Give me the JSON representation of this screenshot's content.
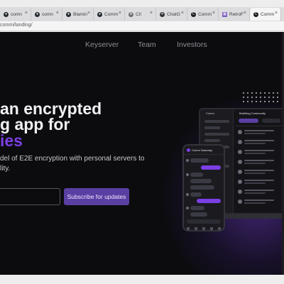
{
  "browser": {
    "tabs": [
      {
        "label": "comn",
        "favicon": "github-icon",
        "active": false
      },
      {
        "label": "comn",
        "favicon": "github-icon",
        "active": false
      },
      {
        "label": "Blamin",
        "favicon": "github-icon",
        "active": false
      },
      {
        "label": "Comm",
        "favicon": "github-icon",
        "active": false
      },
      {
        "label": "CI/",
        "favicon": "gear-icon",
        "active": false
      },
      {
        "label": "ChatG",
        "favicon": "chatgpt-icon",
        "active": false
      },
      {
        "label": "Comm",
        "favicon": "comm-icon",
        "active": false
      },
      {
        "label": "RetroF",
        "favicon": "grid-icon",
        "active": false
      },
      {
        "label": "Comm",
        "favicon": "comm-icon",
        "active": true
      }
    ],
    "close_glyph": "×",
    "url": "comm/landing/"
  },
  "nav": {
    "links": [
      "Keyserver",
      "Team",
      "Investors"
    ]
  },
  "hero": {
    "line1": "an encrypted",
    "line2": "g app for",
    "line3": "ies",
    "subtitle_line1": "del of E2E encryption with personal servers to",
    "subtitle_line2": "lity.",
    "email_placeholder": "",
    "subscribe_label": "Subscribe for updates"
  },
  "mockup": {
    "laptop_title": "Comm",
    "laptop_chat_title": "Bubbling Community",
    "phone_chat_title": "Comm Saturday"
  },
  "colors": {
    "accent": "#7b3fe4",
    "button": "#5a3fa3",
    "page_bg": "#0c0c0f"
  }
}
